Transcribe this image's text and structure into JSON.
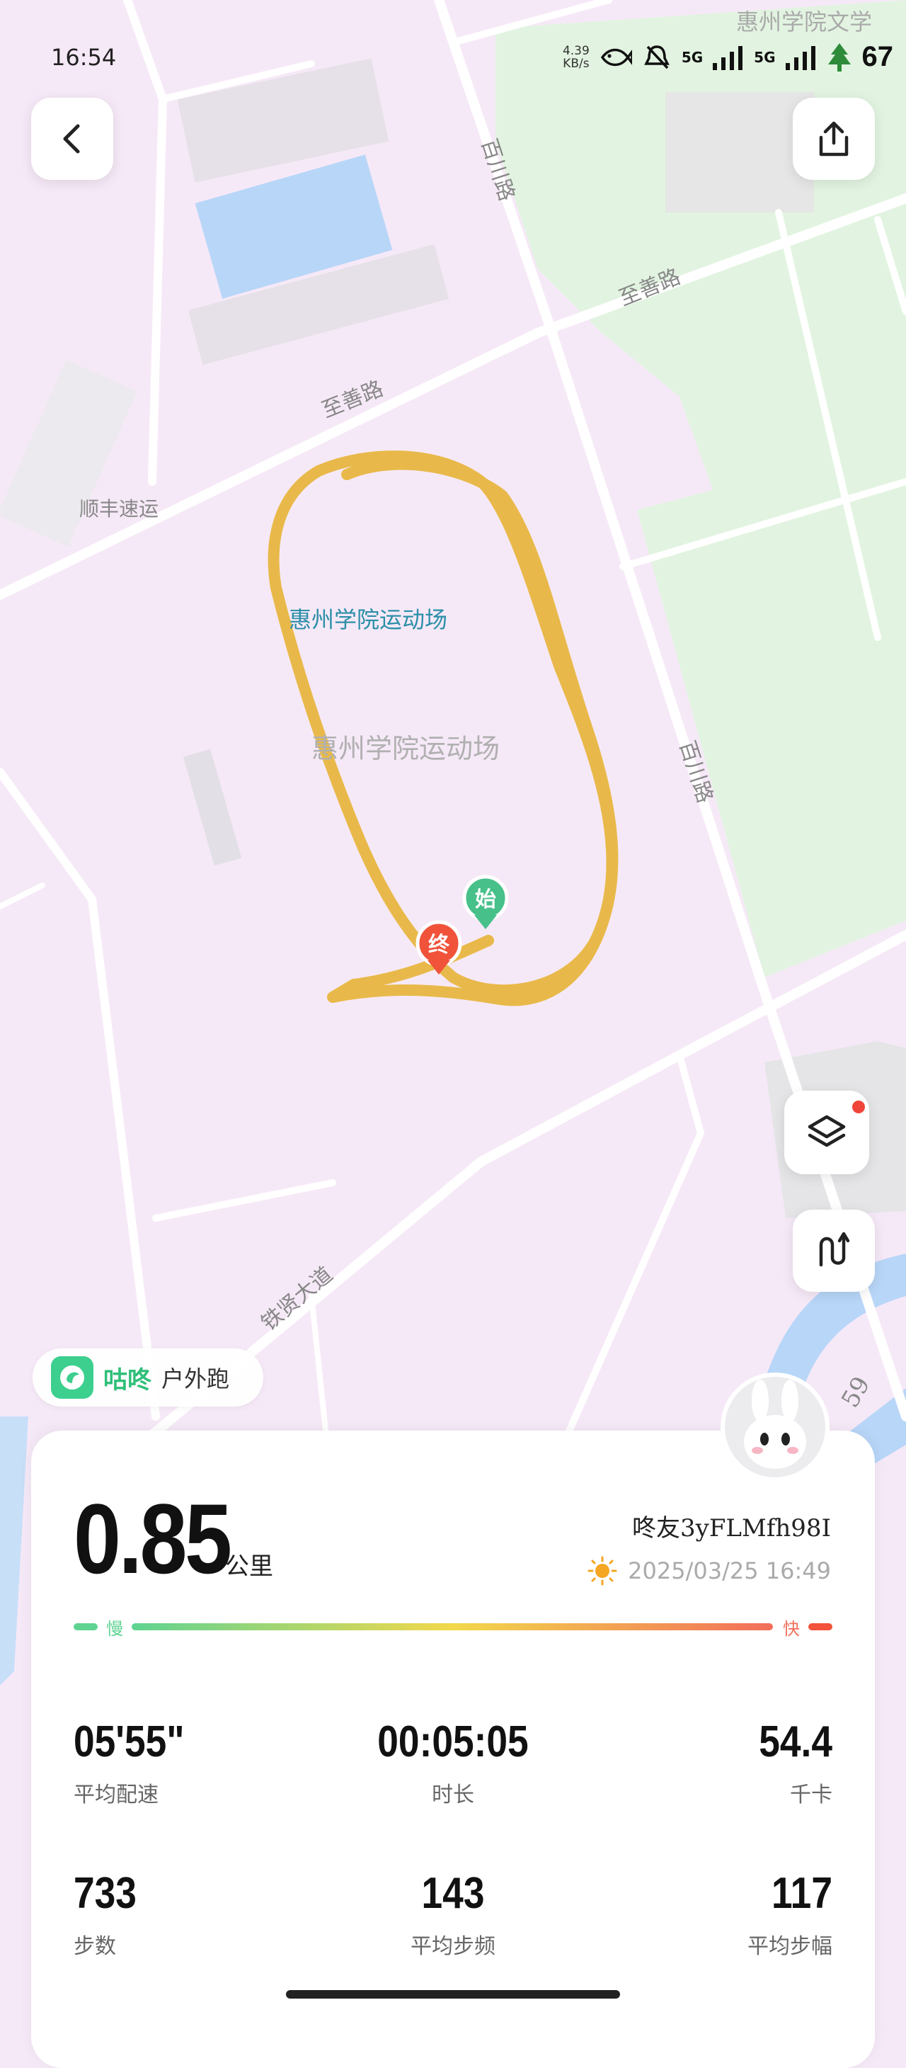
{
  "status_bar": {
    "time": "16:54",
    "net_speed_value": "4.39",
    "net_speed_unit": "KB/s",
    "sim1": "5G",
    "sim2": "5G",
    "battery": "67"
  },
  "map": {
    "roads": [
      {
        "name": "至善路"
      },
      {
        "name": "至善路"
      },
      {
        "name": "百川路"
      },
      {
        "name": "百川路"
      },
      {
        "name": "顺丰速运"
      },
      {
        "name": "铁贤大道"
      },
      {
        "name": "惠州学院运动场"
      },
      {
        "name": "惠州学院运动场"
      },
      {
        "name": "惠州学院文学"
      },
      {
        "name": "59"
      }
    ],
    "start_marker": "始",
    "end_marker": "终",
    "colors": {
      "background": "#f6e9f7",
      "park": "#e2f4e1",
      "water": "#b8d6f8",
      "track": "#e8b94a",
      "start": "#47c08a",
      "end": "#f0533a"
    }
  },
  "buttons": {
    "back": "back-icon",
    "share": "share-icon",
    "layers": "layers-icon",
    "route": "route-icon"
  },
  "brand": {
    "name": "咕咚",
    "subtitle": "户外跑"
  },
  "summary": {
    "distance": "0.85",
    "distance_unit": "公里",
    "user_name": "咚友3yFLMfh98I",
    "datetime": "2025/03/25 16:49",
    "pace_slow": "慢",
    "pace_fast": "快"
  },
  "stats": [
    {
      "value": "05'55\"",
      "label": "平均配速"
    },
    {
      "value": "00:05:05",
      "label": "时长"
    },
    {
      "value": "54.4",
      "label": "千卡"
    },
    {
      "value": "733",
      "label": "步数"
    },
    {
      "value": "143",
      "label": "平均步频"
    },
    {
      "value": "117",
      "label": "平均步幅"
    }
  ]
}
